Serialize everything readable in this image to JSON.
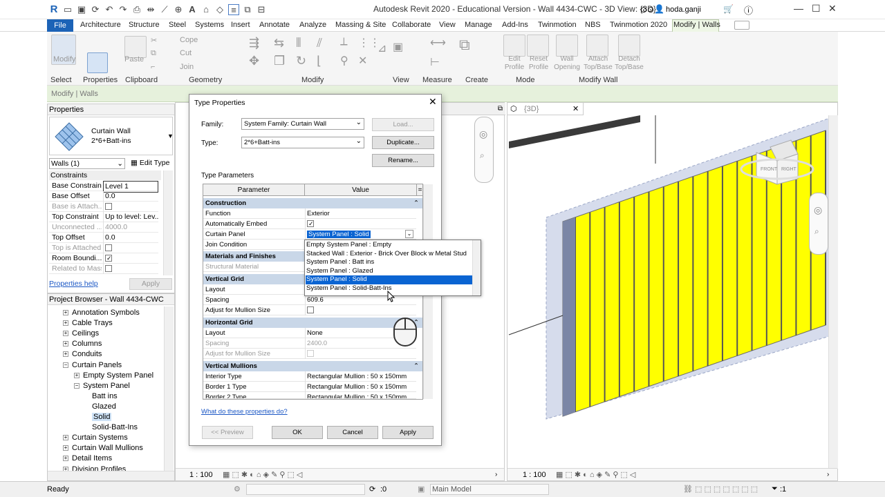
{
  "window": {
    "title": "Autodesk Revit 2020 - Educational Version - Wall 4434-CWC - 3D View: {3D}",
    "user": "hoda.ganji"
  },
  "menu": {
    "file": "File",
    "tabs": [
      "Architecture",
      "Structure",
      "Steel",
      "Systems",
      "Insert",
      "Annotate",
      "Analyze",
      "Massing & Site",
      "Collaborate",
      "View",
      "Manage",
      "Add-Ins",
      "Twinmotion",
      "NBS",
      "Twinmotion 2020",
      "Modify | Walls"
    ]
  },
  "ribbon": {
    "modify": "Modify",
    "paste": "Paste",
    "cope": "Cope",
    "cut": "Cut",
    "join": "Join",
    "edit_profile": "Edit Profile",
    "reset_profile": "Reset Profile",
    "wall_opening": "Wall Opening",
    "attach": "Attach Top/Base",
    "detach": "Detach Top/Base",
    "panels": [
      "Select",
      "Properties",
      "Clipboard",
      "Geometry",
      "Modify",
      "View",
      "Measure",
      "Create",
      "Mode",
      "Modify Wall"
    ]
  },
  "context_label": "Modify | Walls",
  "properties": {
    "title": "Properties",
    "family": "Curtain Wall",
    "type": "2*6+Batt-ins",
    "selector": "Walls (1)",
    "edit_type": "Edit Type",
    "section": "Constraints",
    "rows": [
      {
        "k": "Base Constraint",
        "v": "Level 1"
      },
      {
        "k": "Base Offset",
        "v": "0.0"
      },
      {
        "k": "Base is Attach...",
        "v": ""
      },
      {
        "k": "Top Constraint",
        "v": "Up to level: Lev..."
      },
      {
        "k": "Unconnected ...",
        "v": "4000.0"
      },
      {
        "k": "Top Offset",
        "v": "0.0"
      },
      {
        "k": "Top is Attached",
        "v": ""
      },
      {
        "k": "Room Boundi...",
        "v": ""
      },
      {
        "k": "Related to Mass",
        "v": ""
      }
    ],
    "help": "Properties help",
    "apply": "Apply"
  },
  "browser": {
    "title": "Project Browser - Wall 4434-CWC",
    "items": [
      {
        "t": "Annotation Symbols",
        "lvl": 1,
        "box": "+"
      },
      {
        "t": "Cable Trays",
        "lvl": 1,
        "box": "+"
      },
      {
        "t": "Ceilings",
        "lvl": 1,
        "box": "+"
      },
      {
        "t": "Columns",
        "lvl": 1,
        "box": "+"
      },
      {
        "t": "Conduits",
        "lvl": 1,
        "box": "+"
      },
      {
        "t": "Curtain Panels",
        "lvl": 1,
        "box": "−"
      },
      {
        "t": "Empty System Panel",
        "lvl": 2,
        "box": "+"
      },
      {
        "t": "System Panel",
        "lvl": 2,
        "box": "−"
      },
      {
        "t": "Batt ins",
        "lvl": 3,
        "box": ""
      },
      {
        "t": "Glazed",
        "lvl": 3,
        "box": ""
      },
      {
        "t": "Solid",
        "lvl": 3,
        "box": ""
      },
      {
        "t": "Solid-Batt-Ins",
        "lvl": 3,
        "box": ""
      },
      {
        "t": "Curtain Systems",
        "lvl": 1,
        "box": "+"
      },
      {
        "t": "Curtain Wall Mullions",
        "lvl": 1,
        "box": "+"
      },
      {
        "t": "Detail Items",
        "lvl": 1,
        "box": "+"
      },
      {
        "t": "Division Profiles",
        "lvl": 1,
        "box": "+"
      }
    ]
  },
  "view3d": {
    "tab": "{3D}",
    "scale": "1 : 100",
    "viewcube_front": "FRONT",
    "viewcube_right": "RIGHT"
  },
  "view_left": {
    "scale": "1 : 100"
  },
  "status": {
    "text": "Ready",
    "zero": ":0",
    "model": "Main Model",
    "filter": ":1"
  },
  "dialog": {
    "title": "Type Properties",
    "family_label": "Family:",
    "family_value": "System Family: Curtain Wall",
    "type_label": "Type:",
    "type_value": "2*6+Batt-ins",
    "load": "Load...",
    "duplicate": "Duplicate...",
    "rename": "Rename...",
    "params_label": "Type Parameters",
    "col_param": "Parameter",
    "col_value": "Value",
    "link": "What do these properties do?",
    "preview": "<< Preview",
    "ok": "OK",
    "cancel": "Cancel",
    "apply": "Apply",
    "groups": {
      "construction": "Construction",
      "materials": "Materials and Finishes",
      "vgrid": "Vertical Grid",
      "hgrid": "Horizontal Grid",
      "vmull": "Vertical Mullions"
    },
    "rows": {
      "function": {
        "k": "Function",
        "v": "Exterior"
      },
      "embed": {
        "k": "Automatically Embed",
        "v": ""
      },
      "panel": {
        "k": "Curtain Panel",
        "v": "System Panel : Solid"
      },
      "join": {
        "k": "Join Condition",
        "v": ""
      },
      "struct": {
        "k": "Structural Material",
        "v": ""
      },
      "vlayout": {
        "k": "Layout",
        "v": ""
      },
      "vspacing": {
        "k": "Spacing",
        "v": "609.6"
      },
      "vadjust": {
        "k": "Adjust for Mullion Size",
        "v": ""
      },
      "hlayout": {
        "k": "Layout",
        "v": "None"
      },
      "hspacing": {
        "k": "Spacing",
        "v": "2400.0"
      },
      "hadjust": {
        "k": "Adjust for Mullion Size",
        "v": ""
      },
      "interior": {
        "k": "Interior Type",
        "v": "Rectangular Mullion : 50 x 150mm"
      },
      "border1": {
        "k": "Border 1 Type",
        "v": "Rectangular Mullion : 50 x 150mm"
      },
      "border2": {
        "k": "Border 2 Type",
        "v": "Rectangular Mullion : 50 x 150mm"
      }
    },
    "dropdown": [
      "Empty System Panel : Empty",
      "Stacked Wall : Exterior - Brick Over Block w Metal Stud",
      "System Panel : Batt ins",
      "System Panel : Glazed",
      "System Panel : Solid",
      "System Panel : Solid-Batt-Ins"
    ]
  },
  "colors": {
    "accent": "#1c63b7",
    "panel_yellow": "#ffff00",
    "selection": "#0a64d2",
    "group_header": "#c9d7e8"
  }
}
